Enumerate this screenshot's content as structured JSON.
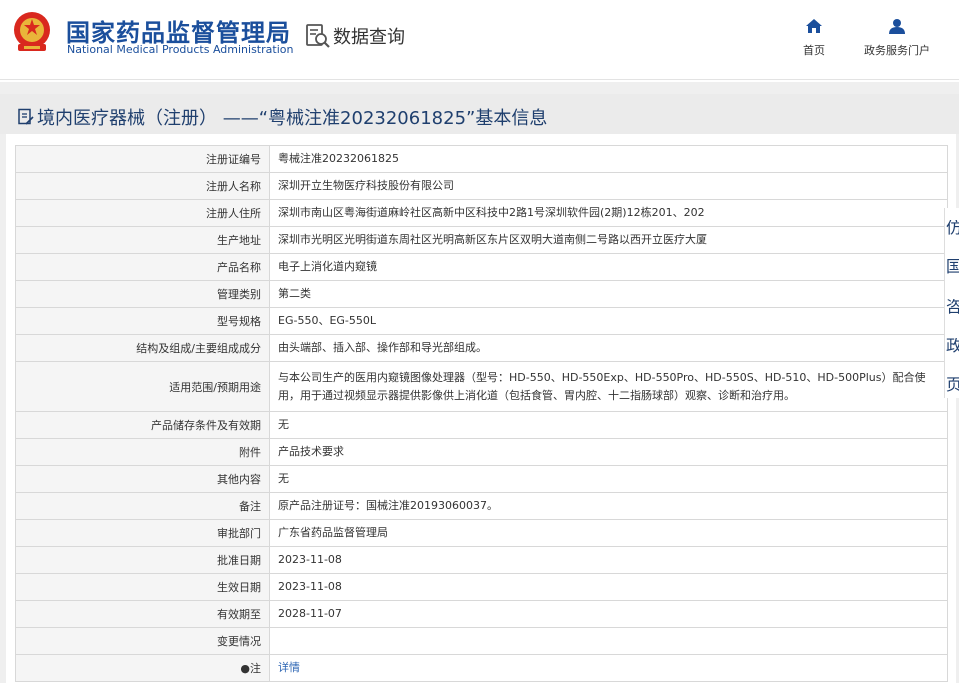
{
  "header": {
    "site_name_cn": "国家药品监督管理局",
    "site_name_en": "National Medical Products Administration",
    "search_label": "数据查询",
    "nav": [
      {
        "label": "首页",
        "icon": "home-icon"
      },
      {
        "label": "政务服务门户",
        "icon": "user-icon"
      }
    ]
  },
  "page": {
    "title": "境内医疗器械（注册） ——“粤械注准20232061825”基本信息"
  },
  "table": {
    "rows": [
      {
        "key": "注册证编号",
        "value": "粤械注准20232061825"
      },
      {
        "key": "注册人名称",
        "value": "深圳开立生物医疗科技股份有限公司"
      },
      {
        "key": "注册人住所",
        "value": "深圳市南山区粤海街道麻岭社区高新中区科技中2路1号深圳软件园(2期)12栋201、202"
      },
      {
        "key": "生产地址",
        "value": "深圳市光明区光明街道东周社区光明高新区东片区双明大道南侧二号路以西开立医疗大厦"
      },
      {
        "key": "产品名称",
        "value": "电子上消化道内窥镜"
      },
      {
        "key": "管理类别",
        "value": "第二类"
      },
      {
        "key": "型号规格",
        "value": "EG-550、EG-550L"
      },
      {
        "key": "结构及组成/主要组成成分",
        "value": "由头端部、插入部、操作部和导光部组成。"
      },
      {
        "key": "适用范围/预期用途",
        "value": "与本公司生产的医用内窥镜图像处理器（型号：HD-550、HD-550Exp、HD-550Pro、HD-550S、HD-510、HD-500Plus）配合使用，用于通过视频显示器提供影像供上消化道（包括食管、胃内腔、十二指肠球部）观察、诊断和治疗用。"
      },
      {
        "key": "产品储存条件及有效期",
        "value": "无"
      },
      {
        "key": "附件",
        "value": "产品技术要求"
      },
      {
        "key": "其他内容",
        "value": "无"
      },
      {
        "key": "备注",
        "value": "原产品注册证号：国械注准20193060037。"
      },
      {
        "key": "审批部门",
        "value": "广东省药品监督管理局"
      },
      {
        "key": "批准日期",
        "value": "2023-11-08"
      },
      {
        "key": "生效日期",
        "value": "2023-11-08"
      },
      {
        "key": "有效期至",
        "value": "2028-11-07"
      },
      {
        "key": "变更情况",
        "value": ""
      },
      {
        "key": "●注",
        "value": "详情"
      }
    ]
  },
  "sidebar": {
    "items": [
      "仿",
      "国",
      "咨",
      "政",
      "页"
    ]
  },
  "colors": {
    "brand_blue": "#1b4f9c",
    "title_blue": "#1f3f6e",
    "link_blue": "#2b64b3",
    "key_bg": "#f5f5f5",
    "border": "#d8d8d8"
  }
}
